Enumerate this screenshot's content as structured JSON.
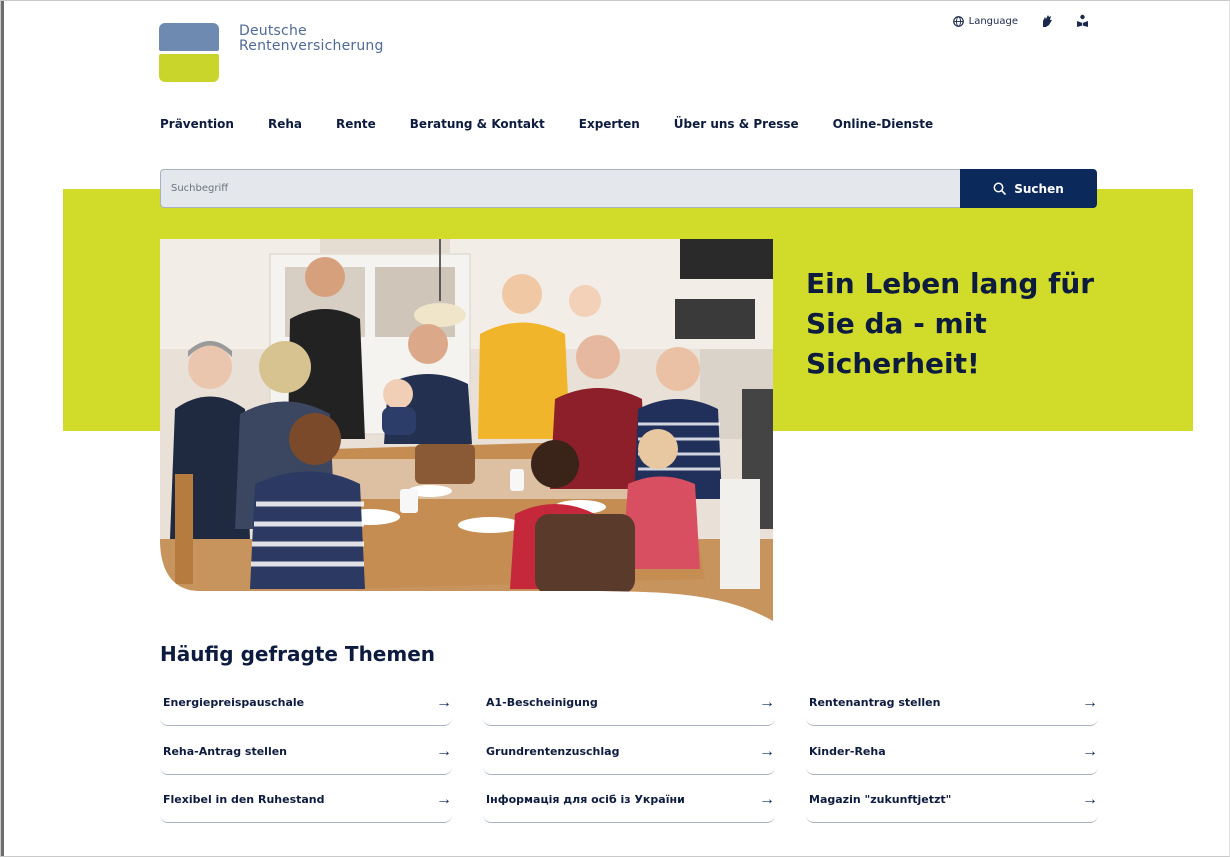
{
  "logo": {
    "line1": "Deutsche",
    "line2": "Rentenversicherung"
  },
  "utility": {
    "language_icon": "globe-icon",
    "language_label": "Language",
    "sign_language_icon": "sign-language-hand-icon",
    "easy_language_icon": "easy-language-reader-icon"
  },
  "nav": {
    "items": [
      {
        "label": "Prävention"
      },
      {
        "label": "Reha"
      },
      {
        "label": "Rente"
      },
      {
        "label": "Beratung & Kontakt"
      },
      {
        "label": "Experten"
      },
      {
        "label": "Über uns & Presse"
      },
      {
        "label": "Online-Dienste"
      }
    ]
  },
  "search": {
    "placeholder": "Suchbegriff",
    "button_label": "Suchen",
    "button_icon": "search-icon"
  },
  "hero": {
    "title": "Ein Leben lang für Sie da - mit Sicherheit!",
    "image": "family-at-dining-table-photo"
  },
  "faq": {
    "heading": "Häufig gefragte Themen",
    "arrow_icon": "arrow-right-icon",
    "items": [
      {
        "label": "Energiepreispauschale"
      },
      {
        "label": "A1-Bescheinigung"
      },
      {
        "label": "Rentenantrag stellen"
      },
      {
        "label": "Reha-Antrag stellen"
      },
      {
        "label": "Grundrentenzuschlag"
      },
      {
        "label": "Kinder-Reha"
      },
      {
        "label": "Flexibel in den Ruhestand"
      },
      {
        "label": "Інформація для осіб із України"
      },
      {
        "label": "Magazin \"zukunftjetzt\""
      }
    ]
  },
  "colors": {
    "brand_green": "#d0dc29",
    "brand_navy": "#0b2a5b",
    "logo_blue": "#6f8ab0",
    "text_dark": "#0d1b3e"
  }
}
